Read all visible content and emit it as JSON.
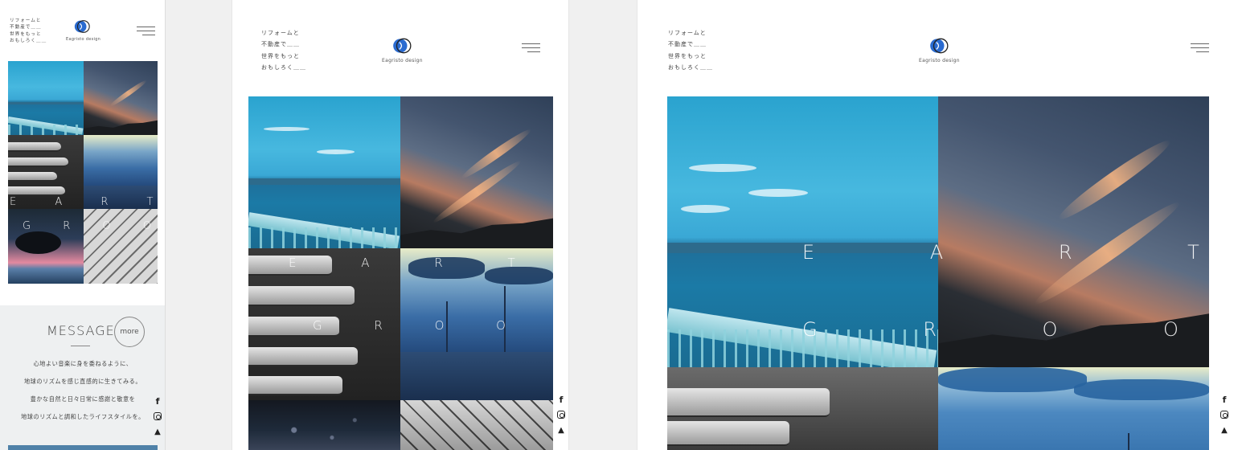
{
  "tagline": [
    "リフォームと",
    "不動産で＿＿",
    "世界をもっと",
    "おもしろく＿＿"
  ],
  "brand": "Eagristo design",
  "hero": {
    "line1": "E A R T H",
    "line2": "G R O O V E"
  },
  "message": {
    "title": "MESSAGE",
    "more": "more",
    "lines": [
      "心地よい音楽に身を委ねるように、",
      "地球のリズムを感じ直感的に生きてみる。",
      "豊かな自然と日々日常に感謝と敬意を",
      "地球のリズムと調和したライフスタイルを。"
    ]
  },
  "social": {
    "facebook": "f",
    "instagram": "",
    "twitter": "🐦"
  },
  "colors": {
    "accent": "#4f81a8",
    "logo_blue": "#2a6bd0",
    "text": "#333333"
  },
  "icons": [
    "hamburger-menu-icon",
    "facebook-icon",
    "instagram-icon",
    "twitter-icon",
    "logo-mark-icon"
  ]
}
